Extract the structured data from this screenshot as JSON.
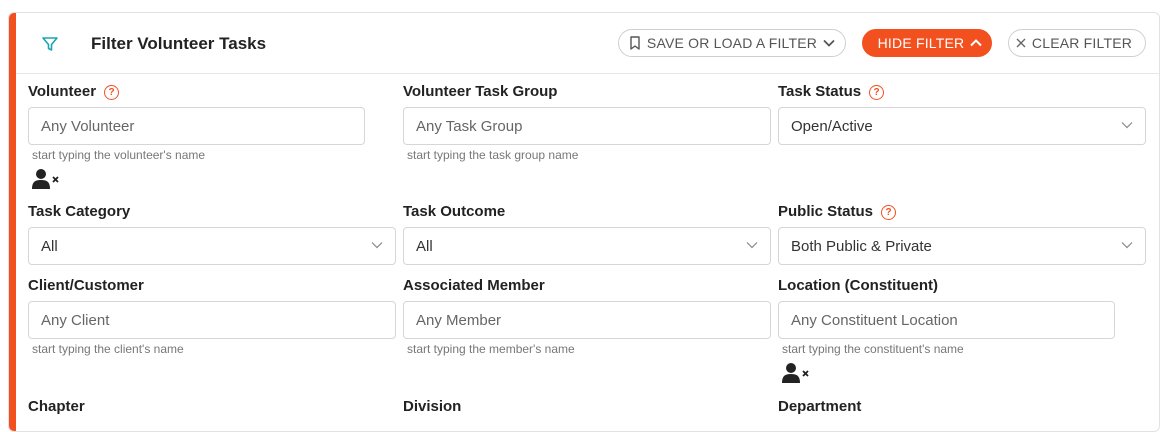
{
  "header": {
    "title": "Filter Volunteer Tasks",
    "save_label": "SAVE OR LOAD A FILTER",
    "hide_label": "HIDE FILTER",
    "clear_label": "CLEAR FILTER"
  },
  "colors": {
    "accent": "#f3501f",
    "filter_icon": "#1aa5b3"
  },
  "fields": {
    "volunteer": {
      "label": "Volunteer",
      "placeholder": "Any Volunteer",
      "hint": "start typing the volunteer's name"
    },
    "task_group": {
      "label": "Volunteer Task Group",
      "placeholder": "Any Task Group",
      "hint": "start typing the task group name"
    },
    "task_status": {
      "label": "Task Status",
      "value": "Open/Active"
    },
    "task_category": {
      "label": "Task Category",
      "value": "All"
    },
    "task_outcome": {
      "label": "Task Outcome",
      "value": "All"
    },
    "public_status": {
      "label": "Public Status",
      "value": "Both Public & Private"
    },
    "client": {
      "label": "Client/Customer",
      "placeholder": "Any Client",
      "hint": "start typing the client's name"
    },
    "member": {
      "label": "Associated Member",
      "placeholder": "Any Member",
      "hint": "start typing the member's name"
    },
    "location": {
      "label": "Location (Constituent)",
      "placeholder": "Any Constituent Location",
      "hint": "start typing the constituent's name"
    },
    "chapter": {
      "label": "Chapter"
    },
    "division": {
      "label": "Division"
    },
    "department": {
      "label": "Department"
    }
  },
  "help_glyph": "?"
}
